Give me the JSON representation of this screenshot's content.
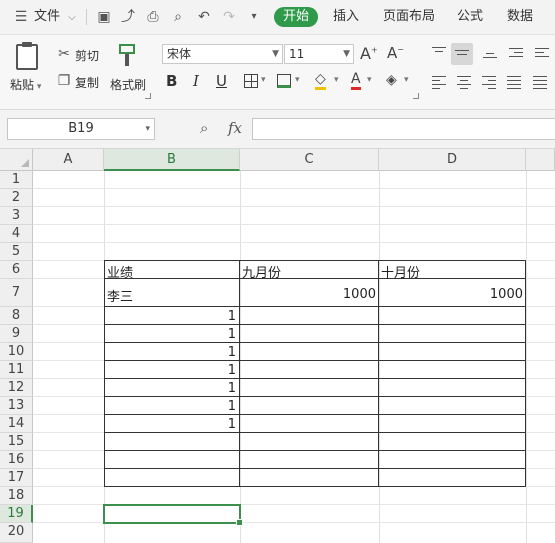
{
  "menubar": {
    "file_label": "文件",
    "tabs": [
      "开始",
      "插入",
      "页面布局",
      "公式",
      "数据"
    ]
  },
  "ribbon": {
    "paste_label": "粘贴",
    "cut_label": "剪切",
    "copy_label": "复制",
    "format_painter_label": "格式刷",
    "font_name": "宋体",
    "font_size": "11"
  },
  "formula_bar": {
    "name_box": "B19",
    "fx_label": "fx",
    "formula": ""
  },
  "sheet": {
    "columns": [
      "A",
      "B",
      "C",
      "D"
    ],
    "rows": [
      "1",
      "2",
      "3",
      "4",
      "5",
      "6",
      "7",
      "8",
      "9",
      "10",
      "11",
      "12",
      "13",
      "14",
      "15",
      "16",
      "17",
      "18",
      "19",
      "20"
    ],
    "selected_cell": "B19",
    "table": {
      "headers": [
        "业绩",
        "九月份",
        "十月份"
      ],
      "row7": [
        "李三",
        "1000",
        "1000"
      ],
      "b_values": [
        "1",
        "1",
        "1",
        "1",
        "1",
        "1",
        "1"
      ]
    }
  },
  "colors": {
    "accent": "#2f9a4a",
    "selection": "#3c8f4d"
  }
}
